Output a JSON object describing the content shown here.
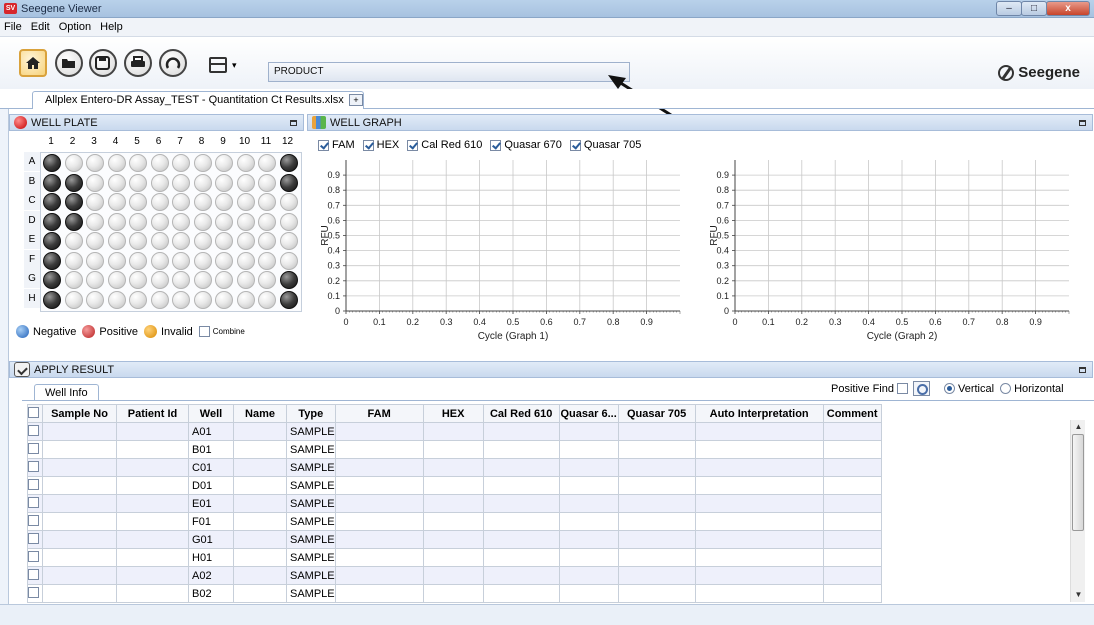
{
  "window": {
    "title": "Seegene Viewer",
    "logo_text": "SV",
    "minimize": "–",
    "maximize": "□",
    "close": "x"
  },
  "menu": [
    "File",
    "Edit",
    "Option",
    "Help"
  ],
  "toolbar": {
    "product_value": "PRODUCT",
    "brand": "Seegene",
    "layout_arrow": "▾"
  },
  "document_tab": {
    "label": "Allplex Entero-DR Assay_TEST - Quantitation Ct Results.xlsx",
    "close": "×",
    "new_tab": "+"
  },
  "well_plate": {
    "title": "WELL PLATE",
    "columns": [
      "1",
      "2",
      "3",
      "4",
      "5",
      "6",
      "7",
      "8",
      "9",
      "10",
      "11",
      "12"
    ],
    "rows": [
      "A",
      "B",
      "C",
      "D",
      "E",
      "F",
      "G",
      "H"
    ],
    "positive_wells": [
      "A1",
      "A12",
      "B1",
      "B2",
      "B12",
      "C1",
      "C2",
      "D1",
      "D2",
      "E1",
      "F1",
      "G1",
      "G12",
      "H1",
      "H12"
    ],
    "legend": {
      "negative": "Negative",
      "positive": "Positive",
      "invalid": "Invalid",
      "combine": "Combine"
    }
  },
  "well_graph": {
    "title": "WELL GRAPH",
    "channels": [
      {
        "label": "FAM",
        "checked": true
      },
      {
        "label": "HEX",
        "checked": true
      },
      {
        "label": "Cal Red 610",
        "checked": true
      },
      {
        "label": "Quasar 670",
        "checked": true
      },
      {
        "label": "Quasar 705",
        "checked": true
      }
    ]
  },
  "chart_data": [
    {
      "type": "line",
      "title": "",
      "xlabel": "Cycle (Graph 1)",
      "ylabel": "RFU",
      "xlim": [
        0,
        1
      ],
      "ylim": [
        0,
        1
      ],
      "xticks": [
        "0",
        "0.1",
        "0.2",
        "0.3",
        "0.4",
        "0.5",
        "0.6",
        "0.7",
        "0.8",
        "0.9"
      ],
      "yticks": [
        "0",
        "0.1",
        "0.2",
        "0.3",
        "0.4",
        "0.5",
        "0.6",
        "0.7",
        "0.8",
        "0.9"
      ],
      "grid": true,
      "series": []
    },
    {
      "type": "line",
      "title": "",
      "xlabel": "Cycle (Graph 2)",
      "ylabel": "RFU",
      "xlim": [
        0,
        1
      ],
      "ylim": [
        0,
        1
      ],
      "xticks": [
        "0",
        "0.1",
        "0.2",
        "0.3",
        "0.4",
        "0.5",
        "0.6",
        "0.7",
        "0.8",
        "0.9"
      ],
      "yticks": [
        "0",
        "0.1",
        "0.2",
        "0.3",
        "0.4",
        "0.5",
        "0.6",
        "0.7",
        "0.8",
        "0.9"
      ],
      "grid": true,
      "series": []
    }
  ],
  "apply_result": {
    "title": "APPLY RESULT",
    "tab": "Well Info",
    "positive_find": "Positive Find",
    "vertical": "Vertical",
    "horizontal": "Horizontal",
    "columns": [
      "Sample No",
      "Patient Id",
      "Well",
      "Name",
      "Type",
      "FAM",
      "HEX",
      "Cal Red 610",
      "Quasar 6...",
      "Quasar 705",
      "Auto  Interpretation",
      "Comment"
    ],
    "rows": [
      {
        "well": "A01",
        "type": "SAMPLE"
      },
      {
        "well": "B01",
        "type": "SAMPLE"
      },
      {
        "well": "C01",
        "type": "SAMPLE"
      },
      {
        "well": "D01",
        "type": "SAMPLE"
      },
      {
        "well": "E01",
        "type": "SAMPLE"
      },
      {
        "well": "F01",
        "type": "SAMPLE"
      },
      {
        "well": "G01",
        "type": "SAMPLE"
      },
      {
        "well": "H01",
        "type": "SAMPLE"
      },
      {
        "well": "A02",
        "type": "SAMPLE"
      },
      {
        "well": "B02",
        "type": "SAMPLE"
      }
    ]
  },
  "colors": {
    "accent": "#2a5c9a",
    "panel_header": "#c9d9ee",
    "positive_well": "#3c3c3c",
    "alt_row": "#eef0fb"
  },
  "scrollbar": {
    "up": "▲",
    "down": "▼"
  }
}
